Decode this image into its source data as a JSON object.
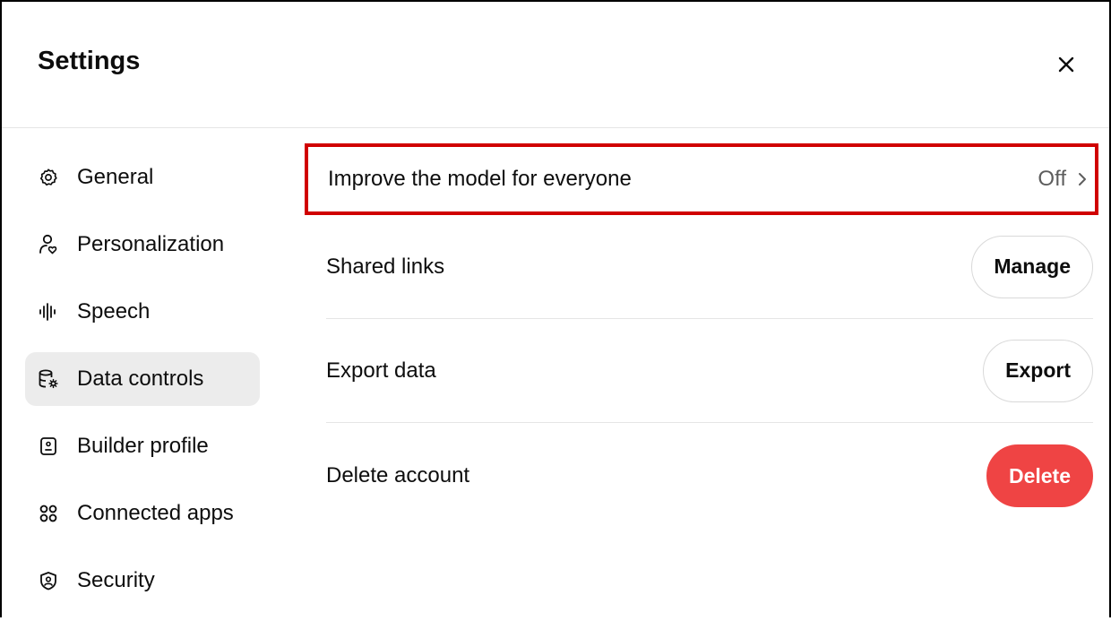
{
  "header": {
    "title": "Settings",
    "close_icon": "close-icon"
  },
  "sidebar": {
    "items": [
      {
        "label": "General",
        "icon": "gear-icon",
        "active": false
      },
      {
        "label": "Personalization",
        "icon": "person-icon",
        "active": false
      },
      {
        "label": "Speech",
        "icon": "waveform-icon",
        "active": false
      },
      {
        "label": "Data controls",
        "icon": "database-icon",
        "active": true
      },
      {
        "label": "Builder profile",
        "icon": "badge-icon",
        "active": false
      },
      {
        "label": "Connected apps",
        "icon": "apps-grid-icon",
        "active": false
      },
      {
        "label": "Security",
        "icon": "shield-icon",
        "active": false
      }
    ]
  },
  "content": {
    "improve_model": {
      "label": "Improve the model for everyone",
      "value": "Off",
      "icon": "chevron-right-icon"
    },
    "shared_links": {
      "label": "Shared links",
      "button": "Manage"
    },
    "export_data": {
      "label": "Export data",
      "button": "Export"
    },
    "delete_account": {
      "label": "Delete account",
      "button": "Delete"
    }
  },
  "colors": {
    "highlight_border": "#d00000",
    "danger": "#ef4444",
    "active_bg": "#ececec"
  }
}
